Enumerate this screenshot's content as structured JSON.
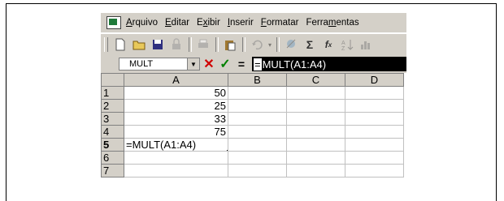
{
  "menu": [
    {
      "pre": "",
      "key": "A",
      "post": "rquivo"
    },
    {
      "pre": "",
      "key": "E",
      "post": "ditar"
    },
    {
      "pre": "E",
      "key": "x",
      "post": "ibir"
    },
    {
      "pre": "",
      "key": "I",
      "post": "nserir"
    },
    {
      "pre": "",
      "key": "F",
      "post": "ormatar"
    },
    {
      "pre": "Ferra",
      "key": "m",
      "post": "entas"
    }
  ],
  "toolbar_icons": [
    "new-icon",
    "open-icon",
    "save-icon",
    "permission-icon",
    "print-icon",
    "paste-icon",
    "undo-icon",
    "hyperlink-icon",
    "autosum-icon",
    "function-icon",
    "sort-icon",
    "chart-icon"
  ],
  "formula_bar": {
    "name_box": "MULT",
    "cancel": "✕",
    "enter": "✓",
    "equals": "=",
    "formula_eq": "=",
    "formula_rest": "MULT(A1:A4)"
  },
  "columns": [
    "A",
    "B",
    "C",
    "D"
  ],
  "rows": [
    {
      "num": "1",
      "a": "50"
    },
    {
      "num": "2",
      "a": "25"
    },
    {
      "num": "3",
      "a": "33"
    },
    {
      "num": "4",
      "a": "75"
    },
    {
      "num": "5",
      "a": "=MULT(A1:A4)"
    },
    {
      "num": "6",
      "a": ""
    },
    {
      "num": "7",
      "a": ""
    }
  ]
}
